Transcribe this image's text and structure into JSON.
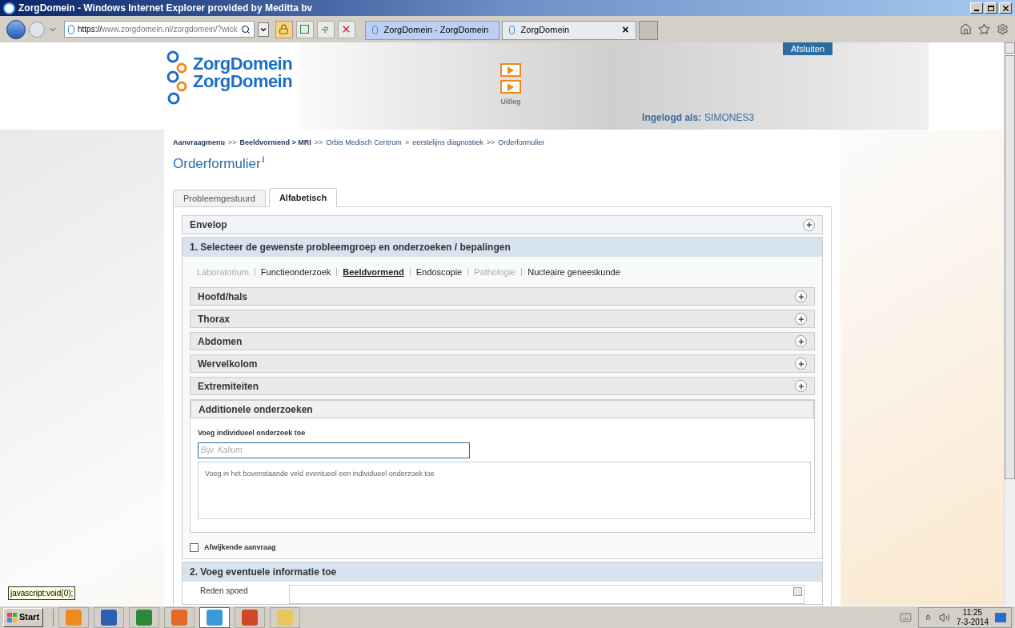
{
  "window": {
    "title": "ZorgDomein - Windows Internet Explorer provided by Meditta bv"
  },
  "address": {
    "url_scheme": "https://",
    "url_host": "www.zorgdomein.nl",
    "url_path": "/zorgdomein/?wick"
  },
  "browser_tabs": [
    {
      "label": "ZorgDomein - ZorgDomein",
      "selected": false
    },
    {
      "label": "ZorgDomein",
      "selected": true,
      "close": "×"
    }
  ],
  "header": {
    "logo": [
      "ZorgDomein",
      "ZorgDomein"
    ],
    "video_label": "Uitleg",
    "logout": "Afsluiten",
    "logged_in_label": "Ingelogd als:",
    "user": "SIMONES3"
  },
  "breadcrumb": [
    {
      "kind": "link",
      "text": "Aanvraagmenu",
      "bold": true
    },
    {
      "kind": "sep",
      "text": ">>"
    },
    {
      "kind": "link",
      "text": "Beeldvormend > MRI",
      "bold": true
    },
    {
      "kind": "sep",
      "text": ">>"
    },
    {
      "kind": "link",
      "text": "Orbis Medisch Centrum",
      "bold": false
    },
    {
      "kind": "sep",
      "text": ">"
    },
    {
      "kind": "link",
      "text": "eerstelijns diagnostiek",
      "bold": false
    },
    {
      "kind": "sep",
      "text": ">>"
    },
    {
      "kind": "link",
      "text": "Orderformulier",
      "bold": false
    }
  ],
  "page_title": {
    "text": "Orderformulier",
    "info": "i"
  },
  "tabs": [
    {
      "label": "Probleemgestuurd",
      "selected": false
    },
    {
      "label": "Alfabetisch",
      "selected": true
    }
  ],
  "envelop": {
    "title": "Envelop",
    "expanded": false
  },
  "section1": {
    "title": "1. Selecteer de gewenste probleemgroep en onderzoeken / bepalingen",
    "categories": [
      {
        "label": "Laboratorium",
        "disabled": true,
        "selected": false
      },
      {
        "label": "Functieonderzoek",
        "disabled": false,
        "selected": false
      },
      {
        "label": "Beeldvormend",
        "disabled": false,
        "selected": true
      },
      {
        "label": "Endoscopie",
        "disabled": false,
        "selected": false
      },
      {
        "label": "Pathologie",
        "disabled": true,
        "selected": false
      },
      {
        "label": "Nucleaire geneeskunde",
        "disabled": false,
        "selected": false
      }
    ],
    "groups": [
      {
        "title": "Hoofd/hals",
        "expanded": false
      },
      {
        "title": "Thorax",
        "expanded": false
      },
      {
        "title": "Abdomen",
        "expanded": false
      },
      {
        "title": "Wervelkolom",
        "expanded": false
      },
      {
        "title": "Extremiteiten",
        "expanded": false
      },
      {
        "title": "Additionele onderzoeken",
        "expanded": true
      }
    ],
    "additional": {
      "field_label": "Voeg individueel onderzoek toe",
      "placeholder": "Bijv. Kalium",
      "list_note": "Voeg in het bovenstaande veld eventueel een individueel onderzoek toe"
    },
    "deviating": {
      "label": "Afwijkende aanvraag",
      "checked": false
    }
  },
  "section2": {
    "title": "2. Voeg eventuele informatie toe",
    "field_label": "Reden spoed"
  },
  "status_tip": "javascript:void(0);",
  "taskbar": {
    "start": "Start",
    "time": "11:25",
    "date": "7-3-2014"
  }
}
